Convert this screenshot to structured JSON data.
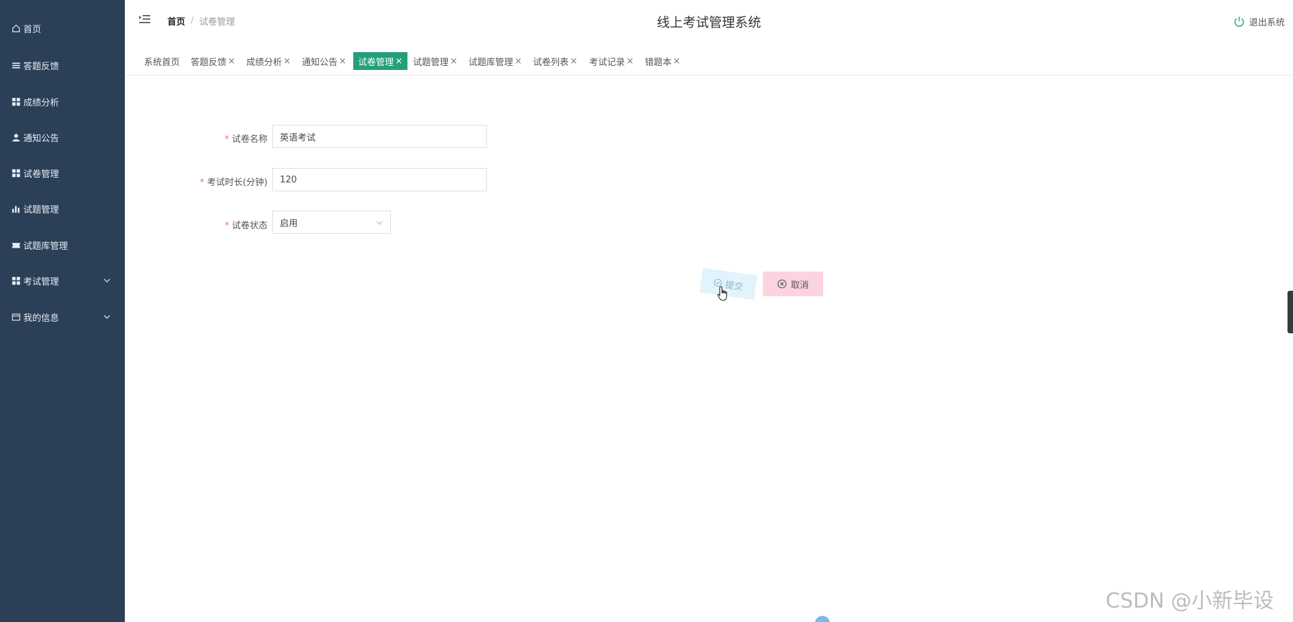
{
  "sidebar": {
    "items": [
      {
        "label": "首页",
        "icon": "home-icon"
      },
      {
        "label": "答题反馈",
        "icon": "list-icon"
      },
      {
        "label": "成绩分析",
        "icon": "grid-icon"
      },
      {
        "label": "通知公告",
        "icon": "user-icon"
      },
      {
        "label": "试卷管理",
        "icon": "grid-icon"
      },
      {
        "label": "试题管理",
        "icon": "bar-chart-icon"
      },
      {
        "label": "试题库管理",
        "icon": "ticket-icon"
      },
      {
        "label": "考试管理",
        "icon": "grid-icon",
        "expandable": true
      },
      {
        "label": "我的信息",
        "icon": "card-icon",
        "expandable": true
      }
    ]
  },
  "header": {
    "breadcrumb_home": "首页",
    "breadcrumb_separator": "/",
    "breadcrumb_current": "试卷管理",
    "system_title": "线上考试管理系统",
    "logout_label": "退出系统"
  },
  "tabs": [
    {
      "label": "系统首页",
      "closable": false,
      "active": false
    },
    {
      "label": "答题反馈",
      "closable": true,
      "active": false
    },
    {
      "label": "成绩分析",
      "closable": true,
      "active": false
    },
    {
      "label": "通知公告",
      "closable": true,
      "active": false
    },
    {
      "label": "试卷管理",
      "closable": true,
      "active": true
    },
    {
      "label": "试题管理",
      "closable": true,
      "active": false
    },
    {
      "label": "试题库管理",
      "closable": true,
      "active": false
    },
    {
      "label": "试卷列表",
      "closable": true,
      "active": false
    },
    {
      "label": "考试记录",
      "closable": true,
      "active": false
    },
    {
      "label": "错题本",
      "closable": true,
      "active": false
    }
  ],
  "tab_close_glyph": "×",
  "form": {
    "required_mark": "*",
    "name_label": "试卷名称",
    "name_value": "英语考试",
    "duration_label": "考试时长(分钟)",
    "duration_value": "120",
    "status_label": "试卷状态",
    "status_value": "启用"
  },
  "actions": {
    "submit_label": "提交",
    "cancel_label": "取消"
  },
  "watermark": "CSDN @小新毕设",
  "colors": {
    "sidebar_bg": "#2b3f57",
    "tab_active_bg": "#23a07a",
    "required": "#f56c6c",
    "cancel_bg": "#fbd4df",
    "submit_bg": "#e3f3fb"
  }
}
